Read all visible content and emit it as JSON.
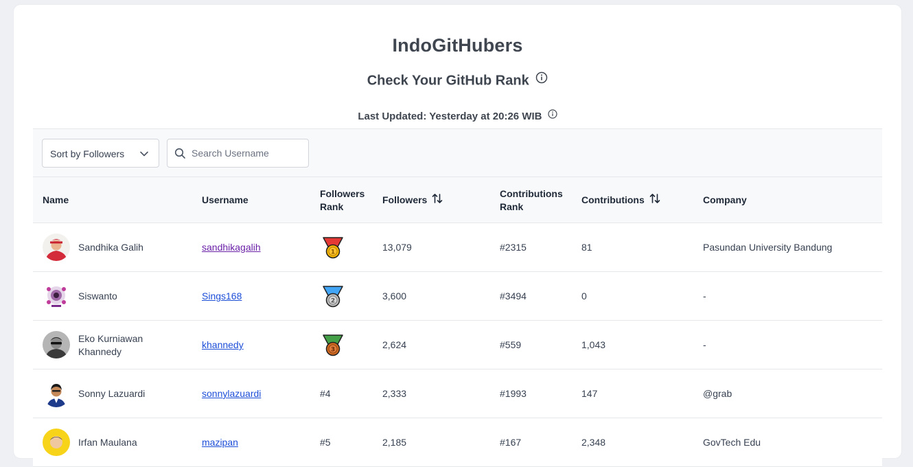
{
  "header": {
    "title": "IndoGitHubers",
    "subtitle": "Check Your GitHub Rank",
    "last_updated": "Last Updated: Yesterday at 20:26 WIB"
  },
  "toolbar": {
    "sort_label": "Sort by Followers",
    "search_placeholder": "Search Username",
    "search_value": ""
  },
  "table": {
    "columns": {
      "name": "Name",
      "username": "Username",
      "followers_rank_1": "Followers",
      "followers_rank_2": "Rank",
      "followers": "Followers",
      "contributions_rank_1": "Contributions",
      "contributions_rank_2": "Rank",
      "contributions": "Contributions",
      "company": "Company"
    },
    "rows": [
      {
        "name": "Sandhika Galih",
        "username": "sandhikagalih",
        "followers_rank": "",
        "followers": "13,079",
        "contributions_rank": "#2315",
        "contributions": "81",
        "company": "Pasundan University Bandung"
      },
      {
        "name": "Siswanto",
        "username": "Sings168",
        "followers_rank": "",
        "followers": "3,600",
        "contributions_rank": "#3494",
        "contributions": "0",
        "company": "-"
      },
      {
        "name_line1": "Eko Kurniawan",
        "name_line2": "Khannedy",
        "username": "khannedy",
        "followers_rank": "",
        "followers": "2,624",
        "contributions_rank": "#559",
        "contributions": "1,043",
        "company": "-"
      },
      {
        "name": "Sonny Lazuardi",
        "username": "sonnylazuardi",
        "followers_rank": "#4",
        "followers": "2,333",
        "contributions_rank": "#1993",
        "contributions": "147",
        "company": "@grab"
      },
      {
        "name": "Irfan Maulana",
        "username": "mazipan",
        "followers_rank": "#5",
        "followers": "2,185",
        "contributions_rank": "#167",
        "contributions": "2,348",
        "company": "GovTech Edu"
      }
    ]
  },
  "colors": {
    "link": "#1d4ed8",
    "link_visited": "#6b21a8",
    "medal_gold": "#e8a317",
    "medal_silver": "#9ca3af",
    "medal_bronze": "#c2692f"
  }
}
